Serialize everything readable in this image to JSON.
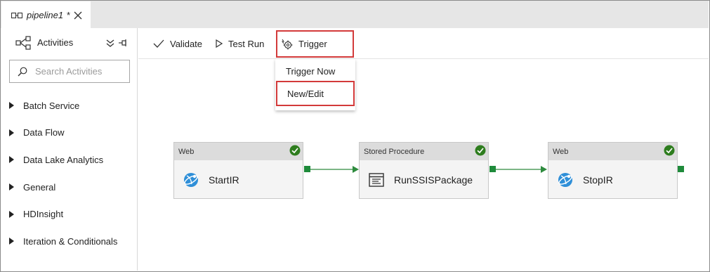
{
  "tab": {
    "title": "pipeline1",
    "dirty_marker": "*"
  },
  "left_panel": {
    "title": "Activities",
    "search_placeholder": "Search Activities",
    "categories": [
      "Batch Service",
      "Data Flow",
      "Data Lake Analytics",
      "General",
      "HDInsight",
      "Iteration & Conditionals"
    ]
  },
  "toolbar": {
    "validate_label": "Validate",
    "test_run_label": "Test Run",
    "trigger_label": "Trigger"
  },
  "trigger_menu": {
    "items": [
      "Trigger Now",
      "New/Edit"
    ]
  },
  "pipeline": {
    "activities": [
      {
        "type": "Web",
        "name": "StartIR",
        "status": "succeeded"
      },
      {
        "type": "Stored Procedure",
        "name": "RunSSISPackage",
        "status": "succeeded"
      },
      {
        "type": "Web",
        "name": "StopIR",
        "status": "succeeded"
      }
    ]
  },
  "colors": {
    "highlight": "#d33a3a",
    "success": "#2e7d1e",
    "connector": "#1f8b3b",
    "web_icon": "#2f8fd8"
  }
}
